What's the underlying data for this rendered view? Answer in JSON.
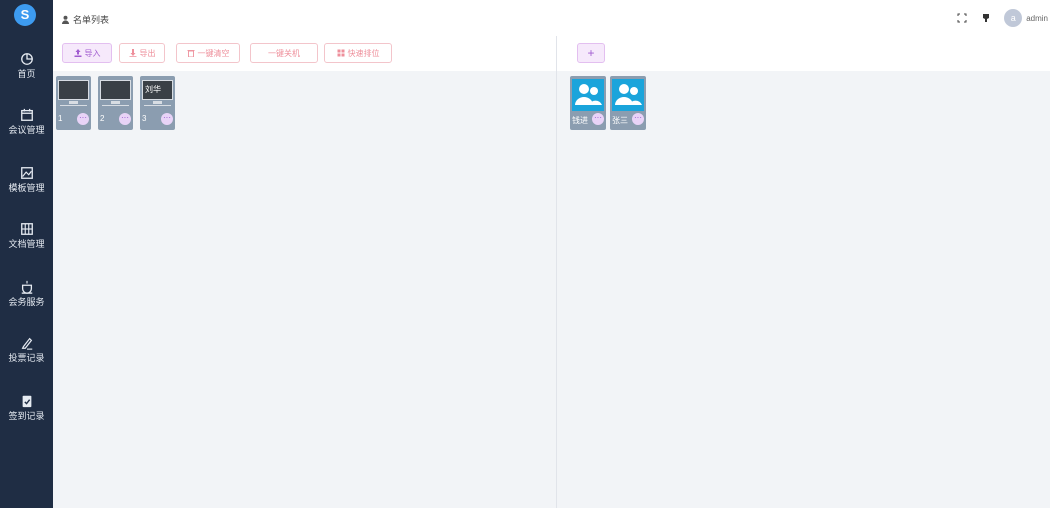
{
  "app": {
    "logo_text": "S"
  },
  "sidebar": {
    "items": [
      {
        "label": "首页",
        "icon": "dashboard-icon"
      },
      {
        "label": "会议管理",
        "icon": "calendar-icon"
      },
      {
        "label": "模板管理",
        "icon": "image-icon"
      },
      {
        "label": "文档管理",
        "icon": "film-icon"
      },
      {
        "label": "会务服务",
        "icon": "cup-icon"
      },
      {
        "label": "投票记录",
        "icon": "pen-icon"
      },
      {
        "label": "签到记录",
        "icon": "clipboard-check-icon"
      }
    ]
  },
  "header": {
    "breadcrumb": "名单列表",
    "user": {
      "avatar_letter": "a",
      "name": "admin"
    }
  },
  "left_panel": {
    "toolbar": {
      "import": "导入",
      "export": "导出",
      "clear": "一键清空",
      "shutdown": "一键关机",
      "quick_sort": "快速排位"
    },
    "devices": [
      {
        "number": "1",
        "name": ""
      },
      {
        "number": "2",
        "name": ""
      },
      {
        "number": "3",
        "name": "刘华"
      }
    ]
  },
  "right_panel": {
    "toolbar": {
      "add": "+"
    },
    "participants": [
      {
        "name": "钱进"
      },
      {
        "name": "张三"
      }
    ]
  },
  "colors": {
    "sidebar_bg": "#1f2d44",
    "accent_purple": "#a15cd0",
    "accent_pink": "#ee8f9b",
    "tile_bg": "#8b9db0",
    "avatar_blue": "#1aa4db"
  }
}
